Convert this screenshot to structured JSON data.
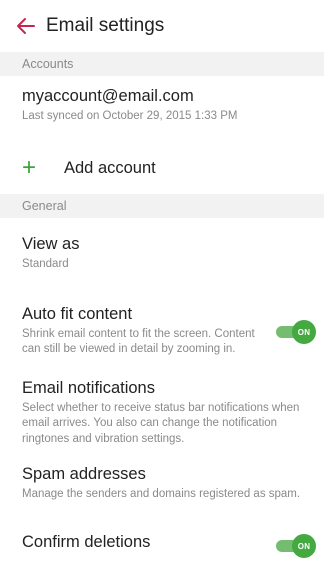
{
  "header": {
    "title": "Email settings"
  },
  "sections": {
    "accounts_label": "Accounts",
    "general_label": "General"
  },
  "account": {
    "email": "myaccount@email.com",
    "sync_status": "Last synced on October 29, 2015  1:33 PM"
  },
  "add_account": {
    "label": "Add account"
  },
  "settings": {
    "view_as": {
      "title": "View as",
      "value": "Standard"
    },
    "auto_fit": {
      "title": "Auto fit content",
      "description": "Shrink email content to fit the screen. Content can still be viewed in detail by zooming in.",
      "toggle_label": "ON",
      "enabled": true
    },
    "notifications": {
      "title": "Email notifications",
      "description": "Select whether to receive status bar notifications when email arrives. You also can change the notification ringtones and vibration settings."
    },
    "spam": {
      "title": "Spam addresses",
      "description": "Manage the senders and domains registered as spam."
    },
    "confirm_deletions": {
      "title": "Confirm deletions",
      "toggle_label": "ON",
      "enabled": true
    }
  },
  "colors": {
    "accent": "#c2185b",
    "toggle_on": "#43a940",
    "add_icon": "#3aa63a",
    "section_bg": "#f2f2f2"
  }
}
